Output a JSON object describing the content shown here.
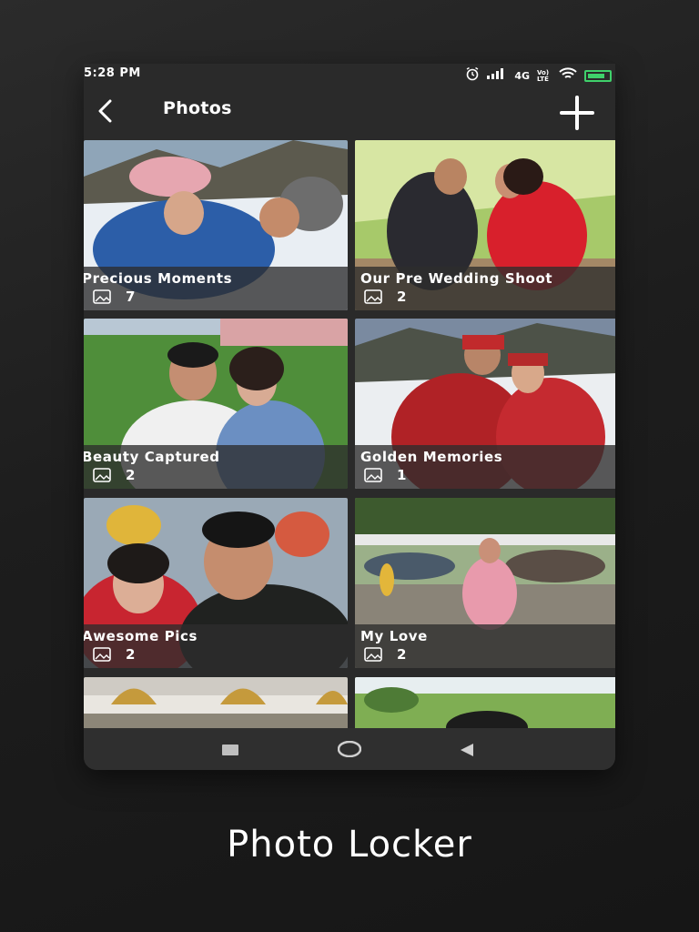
{
  "status_bar": {
    "time": "5:28 PM",
    "network": "4G",
    "volte": "Vo) LTE",
    "icons": [
      "alarm-icon",
      "signal-icon",
      "wifi-icon",
      "battery-icon"
    ],
    "battery_color": "#3fd16b"
  },
  "app_bar": {
    "title": "Photos",
    "back_icon": "chevron-left-icon",
    "add_icon": "plus-icon"
  },
  "albums": [
    {
      "title": "Precious Moments",
      "count": "7"
    },
    {
      "title": "Our Pre Wedding Shoot",
      "count": "2"
    },
    {
      "title": "Beauty Captured",
      "count": "2"
    },
    {
      "title": "Golden Memories",
      "count": "1"
    },
    {
      "title": "Awesome Pics",
      "count": "2"
    },
    {
      "title": "My Love",
      "count": "2"
    },
    {
      "title": "",
      "count": ""
    },
    {
      "title": "",
      "count": ""
    }
  ],
  "nav_bar": {
    "icons": [
      "recents-square-icon",
      "home-circle-icon",
      "back-triangle-icon"
    ]
  },
  "app_caption": "Photo Locker"
}
